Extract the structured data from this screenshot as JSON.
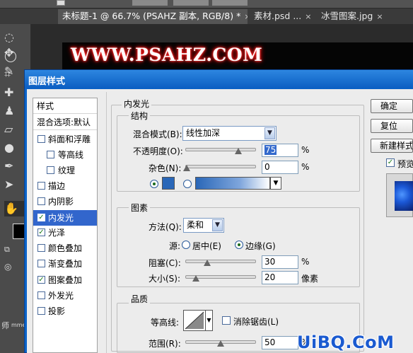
{
  "document_tabs": [
    {
      "label": "未标题-1 @ 66.7% (PSAHZ 副本, RGB/8) *",
      "close": "×"
    },
    {
      "label": "素材.psd ...",
      "close": "×"
    },
    {
      "label": "冰雪图案.jpg",
      "close": "×"
    }
  ],
  "canvas": {
    "watermark_text": "WWW.PSAHZ.COM"
  },
  "dialog": {
    "title": "图层样式",
    "styles_header": "样式",
    "blend_options": "混合选项:默认",
    "styles": [
      {
        "label": "斜面和浮雕",
        "checked": false
      },
      {
        "label": "等高线",
        "checked": false,
        "indent": true
      },
      {
        "label": "纹理",
        "checked": false,
        "indent": true
      },
      {
        "label": "描边",
        "checked": false
      },
      {
        "label": "内阴影",
        "checked": false
      },
      {
        "label": "内发光",
        "checked": true,
        "selected": true
      },
      {
        "label": "光泽",
        "checked": true
      },
      {
        "label": "颜色叠加",
        "checked": false
      },
      {
        "label": "渐变叠加",
        "checked": false
      },
      {
        "label": "图案叠加",
        "checked": true
      },
      {
        "label": "外发光",
        "checked": false
      },
      {
        "label": "投影",
        "checked": false
      }
    ],
    "section_title": "内发光",
    "structure": {
      "title": "结构",
      "blend_mode_label": "混合模式(B):",
      "blend_mode_value": "线性加深",
      "opacity_label": "不透明度(O):",
      "opacity_value": "75",
      "noise_label": "杂色(N):",
      "noise_value": "0",
      "unit_percent": "%",
      "solid_color": "#2a67b8"
    },
    "elements": {
      "title": "图素",
      "technique_label": "方法(Q):",
      "technique_value": "柔和",
      "source_label": "源:",
      "source_center": "居中(E)",
      "source_edge": "边缘(G)",
      "choke_label": "阻塞(C):",
      "choke_value": "30",
      "size_label": "大小(S):",
      "size_value": "20",
      "size_unit": "像素",
      "unit_percent": "%"
    },
    "quality": {
      "title": "品质",
      "contour_label": "等高线:",
      "antialias_label": "消除锯齿(L)",
      "range_label": "范围(R):",
      "range_value": "50",
      "unit_percent": "%"
    },
    "buttons": {
      "ok": "确定",
      "cancel": "复位",
      "new_style": "新建样式",
      "preview": "预览"
    }
  },
  "left_panel_text": "师",
  "left_panel_text2": "mme",
  "logo": "UiBQ.CoM",
  "colors": {
    "dialog_blue": "#0a63c9",
    "selection_blue": "#3266cc"
  }
}
